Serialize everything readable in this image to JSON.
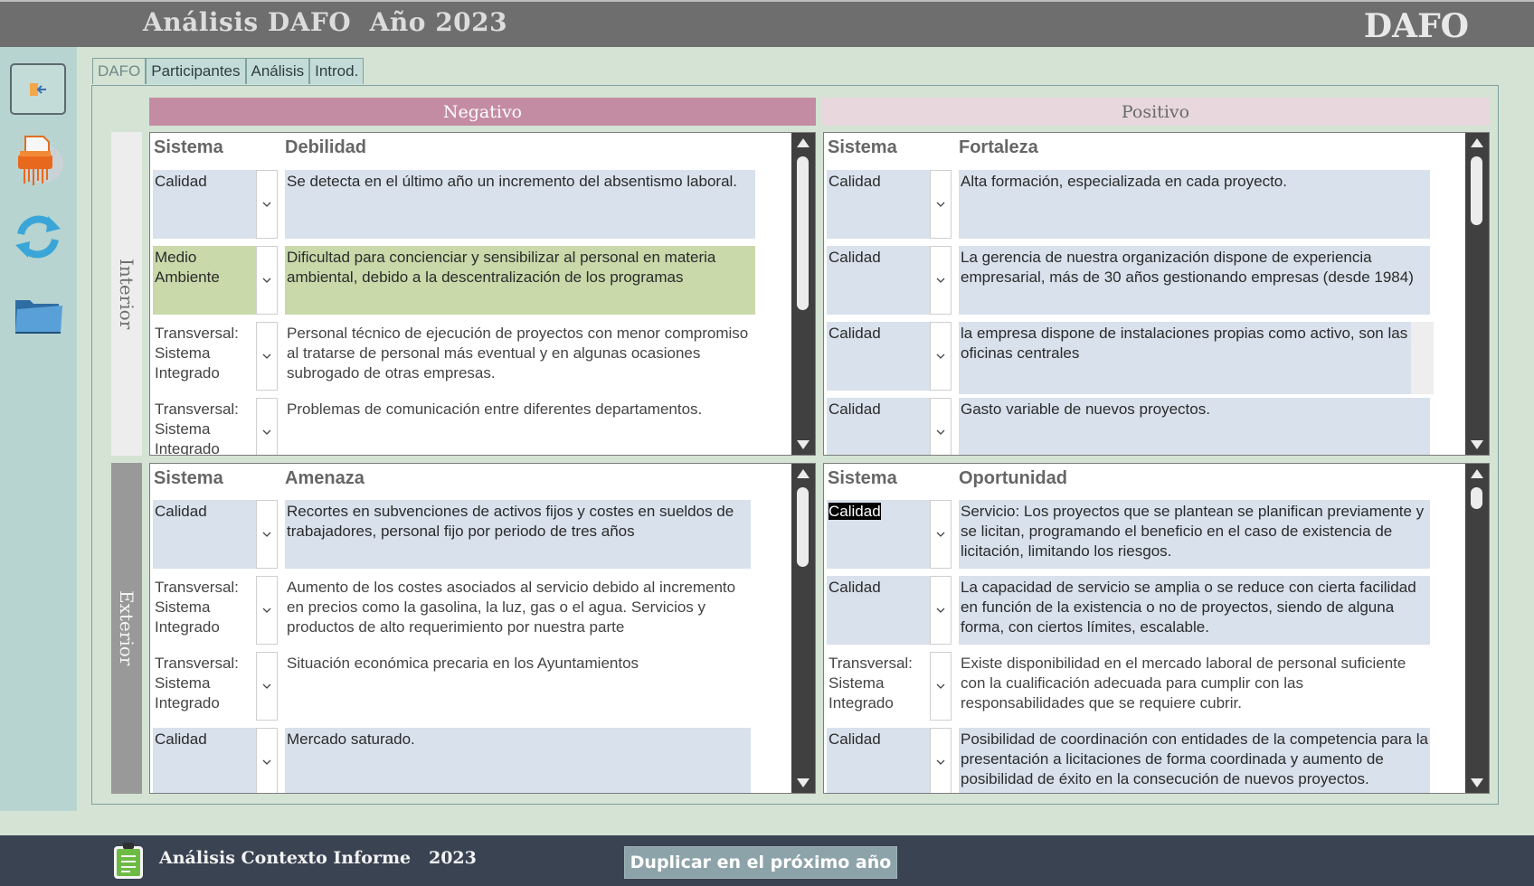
{
  "app": {
    "title": "Análisis DAFO  Año 2023",
    "code": "DAFO"
  },
  "sidebar": {
    "exit_icon": "exit-icon",
    "shredder_icon": "shredder-icon",
    "refresh_icon": "refresh-icon",
    "folder_icon": "folder-icon"
  },
  "tabs": [
    {
      "label": "DAFO",
      "active": true
    },
    {
      "label": "Participantes"
    },
    {
      "label": "Análisis"
    },
    {
      "label": "Introd."
    }
  ],
  "headers": {
    "negativo": "Negativo",
    "positivo": "Positivo",
    "interior": "Interior",
    "exterior": "Exterior"
  },
  "quadrants": {
    "debilidad": {
      "col_sistema": "Sistema",
      "col_texto": "Debilidad",
      "rows": [
        {
          "sistema": "Calidad",
          "texto": "Se detecta en el último año un incremento del absentismo laboral.",
          "style": "blue"
        },
        {
          "sistema": "Medio Ambiente",
          "texto": "Dificultad para concienciar y sensibilizar al personal en materia ambiental, debido a la descentralización de los programas",
          "style": "green"
        },
        {
          "sistema": "Transversal: Sistema Integrado",
          "texto": "Personal técnico de ejecución de proyectos con menor compromiso al tratarse de personal más eventual y en algunas ocasiones subrogado de otras empresas.",
          "style": "plain"
        },
        {
          "sistema": "Transversal: Sistema Integrado",
          "texto": "Problemas de comunicación entre diferentes departamentos.",
          "style": "plain"
        }
      ]
    },
    "fortaleza": {
      "col_sistema": "Sistema",
      "col_texto": "Fortaleza",
      "rows": [
        {
          "sistema": "Calidad",
          "texto": "Alta formación, especializada en cada proyecto.",
          "style": "blue"
        },
        {
          "sistema": "Calidad",
          "texto": "La gerencia de nuestra organización dispone de experiencia empresarial, más de 30 años gestionando empresas (desde 1984)",
          "style": "blue"
        },
        {
          "sistema": "Calidad",
          "texto": "la empresa dispone de instalaciones propias como activo, son las oficinas centrales",
          "style": "blue"
        },
        {
          "sistema": "Calidad",
          "texto": "Gasto variable de nuevos proyectos.",
          "style": "blue"
        }
      ]
    },
    "amenaza": {
      "col_sistema": "Sistema",
      "col_texto": "Amenaza",
      "rows": [
        {
          "sistema": "Calidad",
          "texto": "Recortes en subvenciones de activos fijos y costes en sueldos de trabajadores, personal fijo por periodo de tres años",
          "style": "blue"
        },
        {
          "sistema": "Transversal: Sistema Integrado",
          "texto": "Aumento de los costes asociados al servicio debido al incremento en precios como la gasolina, la luz, gas o el agua. Servicios y productos de alto requerimiento por nuestra parte",
          "style": "plain"
        },
        {
          "sistema": "Transversal: Sistema Integrado",
          "texto": "Situación económica precaria en los Ayuntamientos",
          "style": "plain"
        },
        {
          "sistema": "Calidad",
          "texto": "Mercado saturado.",
          "style": "blue"
        }
      ]
    },
    "oportunidad": {
      "col_sistema": "Sistema",
      "col_texto": "Oportunidad",
      "rows": [
        {
          "sistema": "Calidad",
          "texto": "Servicio: Los proyectos que se plantean se planifican previamente y se licitan, programando el beneficio en el caso de existencia de licitación, limitando los riesgos.",
          "style": "blue",
          "selected": true
        },
        {
          "sistema": "Calidad",
          "texto": "La capacidad de servicio se amplia o se reduce con cierta facilidad en función de la existencia o no de proyectos, siendo de alguna forma, con ciertos límites, escalable.",
          "style": "blue"
        },
        {
          "sistema": "Transversal: Sistema Integrado",
          "texto": "Existe disponibilidad en el mercado laboral de personal suficiente con la cualificación adecuada para cumplir con las responsabilidades que se requiere cubrir.",
          "style": "plain"
        },
        {
          "sistema": "Calidad",
          "texto": "Posibilidad de coordinación con entidades de la competencia para la presentación a licitaciones de forma coordinada y aumento de posibilidad de éxito en la consecución de nuevos proyectos.",
          "style": "blue"
        }
      ]
    }
  },
  "footer": {
    "title": "Análisis Contexto Informe   2023",
    "duplicate_label": "Duplicar en el próximo año",
    "report_icon": "clipboard-icon"
  }
}
